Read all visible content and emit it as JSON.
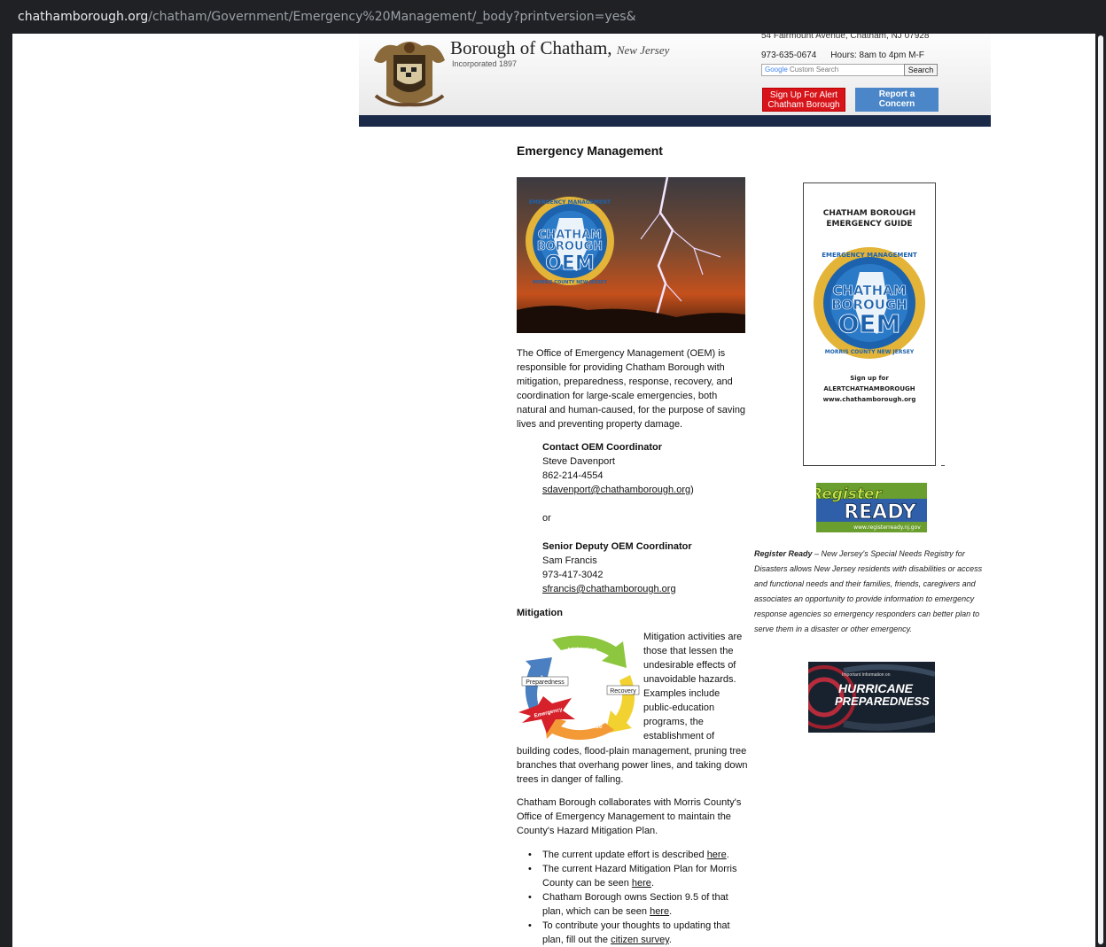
{
  "browser": {
    "url_domain": "chathamborough.org",
    "url_path": "/chatham/Government/Emergency%20Management/_body?printversion=yes&"
  },
  "header": {
    "borough_name": "Borough of Chatham,",
    "state": "New Jersey",
    "incorporated": "Incorporated 1897",
    "address": "54 Fairmount Avenue, Chatham, NJ 07928",
    "phone": "973-635-0674",
    "hours": "Hours: 8am to 4pm M-F",
    "search_brand": "Google",
    "search_placeholder": "Custom Search",
    "search_button": "Search",
    "alert_line1": "Sign Up For Alert",
    "alert_line2": "Chatham Borough",
    "report_line1": "Report a",
    "report_line2": "Concern"
  },
  "main": {
    "title": "Emergency Management",
    "hero_logo": {
      "arc_top": "EMERGENCY MANAGEMENT",
      "line1": "CHATHAM",
      "line2": "BOROUGH",
      "line3": "OEM",
      "arc_bottom": "MORRIS COUNTY NEW JERSEY"
    },
    "intro": "The Office of Emergency Management (OEM) is responsible for providing Chatham Borough with mitigation, preparedness, response, recovery, and coordination for large-scale emergencies, both natural and human-caused, for the purpose of saving lives and preventing property damage.",
    "contact1": {
      "title": "Contact OEM Coordinator",
      "name": "Steve Davenport",
      "phone": "862-214-4554",
      "email": "sdavenport@chathamborough.org",
      "suffix": ")"
    },
    "or": "or",
    "contact2": {
      "title": "Senior Deputy OEM Coordinator",
      "name": "Sam Francis",
      "phone": "973-417-3042",
      "email": "sfrancis@chathamborough.org"
    },
    "mitigation_heading": "Mitigation",
    "cycle_labels": {
      "mitigation": "Mitigation",
      "preparedness": "Preparedness",
      "recovery": "Recovery",
      "response": "Response",
      "emergency": "Emergency"
    },
    "mitigation_text": "Mitigation activities are those that lessen the undesirable effects of unavoidable hazards. Examples include public-education programs, the establishment of",
    "mitigation_cont": "building codes, flood-plain management, pruning tree branches that overhang power lines, and taking down trees in danger of falling.",
    "collab": "Chatham Borough collaborates with Morris County's Office of Emergency Management to maintain the County's Hazard Mitigation Plan.",
    "bullets": [
      {
        "pre": "The current update effort is described ",
        "link": "here",
        "post": "."
      },
      {
        "pre": "The current Hazard Mitigation Plan for Morris County can be seen ",
        "link": "here",
        "post": "."
      },
      {
        "pre": "Chatham Borough owns Section 9.5 of that plan, which can be seen ",
        "link": "here",
        "post": "."
      },
      {
        "pre": "To contribute your thoughts to updating that plan, fill out the ",
        "link": "citizen survey",
        "post": "."
      }
    ]
  },
  "sidebar": {
    "guide_title1": "CHATHAM BOROUGH",
    "guide_title2": "EMERGENCY GUIDE",
    "guide_sign1": "Sign up for",
    "guide_sign2": "ALERTCHATHAMBOROUGH",
    "guide_sign3": "www.chathamborough.org",
    "register_line1": "Register",
    "register_line2": "READY",
    "register_url": "www.registerready.nj.gov",
    "rr_bold": "Register Ready",
    "rr_text": " – New Jersey's Special Needs Registry for Disasters allows New Jersey residents with disabilities or access and functional needs and their families, friends, caregivers and associates an opportunity to provide information to emergency response agencies so emergency responders can better plan to serve them in a disaster or other emergency.",
    "hurricane_small": "Important Information on",
    "hurricane_line1": "HURRICANE",
    "hurricane_line2": "PREPAREDNESS"
  }
}
